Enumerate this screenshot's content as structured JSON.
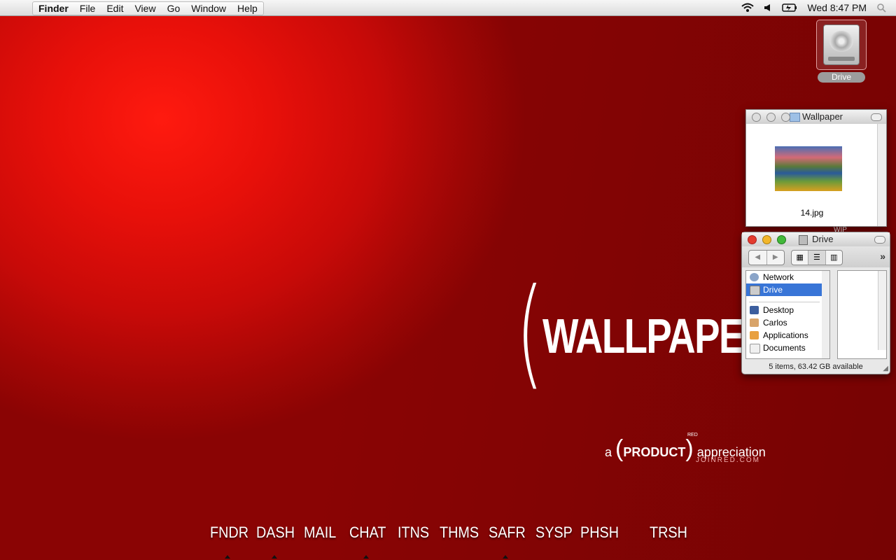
{
  "menubar": {
    "apple_icon": "apple-icon",
    "items": [
      "Finder",
      "File",
      "Edit",
      "View",
      "Go",
      "Window",
      "Help"
    ],
    "clock": "Wed 8:47 PM"
  },
  "desktop_icons": [
    {
      "label": "Drive",
      "icon": "hard-drive-icon"
    }
  ],
  "wallpaper_window": {
    "title": "Wallpaper",
    "files": [
      {
        "name": "14.jpg"
      }
    ],
    "below_label": "WIP"
  },
  "drive_window": {
    "title": "Drive",
    "sidebar": {
      "devices": [
        {
          "label": "Network",
          "icon": "network-icon"
        },
        {
          "label": "Drive",
          "icon": "hard-drive-icon",
          "selected": true
        }
      ],
      "places": [
        {
          "label": "Desktop",
          "icon": "desktop-folder-icon"
        },
        {
          "label": "Carlos",
          "icon": "home-icon"
        },
        {
          "label": "Applications",
          "icon": "applications-icon"
        },
        {
          "label": "Documents",
          "icon": "documents-icon"
        }
      ]
    },
    "status": "5 items, 63.42 GB available"
  },
  "wallpaper_art": {
    "headline": "WALLPAPER",
    "tagline_pre": "a",
    "tagline_product": "PRODUCT",
    "tagline_red": "RED",
    "tagline_post": "appreciation",
    "url": "JOINRED.COM"
  },
  "dock": {
    "items": [
      {
        "label": "FNDR",
        "running": true
      },
      {
        "label": "DASH",
        "running": true
      },
      {
        "label": "MAIL",
        "running": false
      },
      {
        "label": "CHAT",
        "running": true
      },
      {
        "label": "ITNS",
        "running": false
      },
      {
        "label": "THMS",
        "running": false
      },
      {
        "label": "SAFR",
        "running": true
      },
      {
        "label": "SYSP",
        "running": false
      },
      {
        "label": "PHSH",
        "running": false
      },
      {
        "label": "TRSH",
        "running": false
      }
    ]
  }
}
